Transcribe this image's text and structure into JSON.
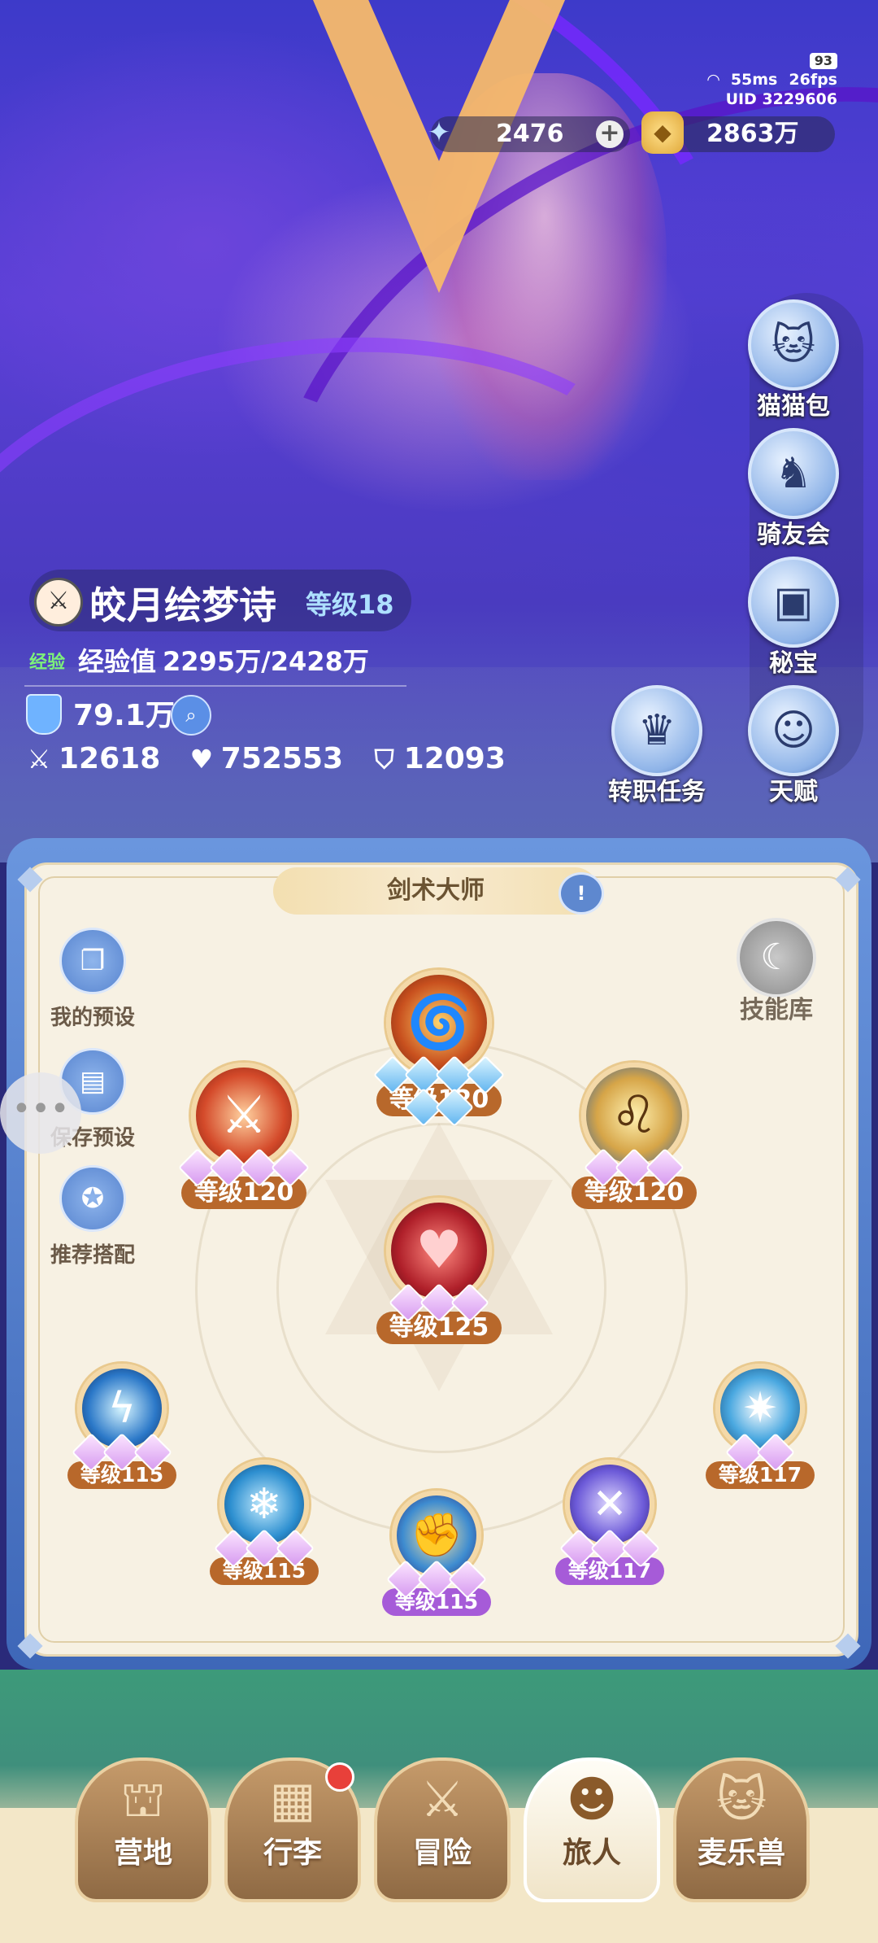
{
  "status": {
    "battery": "93",
    "ping": "55ms",
    "fps": "26fps",
    "uid": "UID 3229606"
  },
  "currency": {
    "gems": "2476",
    "gold": "2863万",
    "gem_icon": "star-crystal-icon",
    "gold_icon": "gold-coin-icon"
  },
  "side_menu": [
    {
      "label": "猫猫包",
      "icon": "cat-bag-icon"
    },
    {
      "label": "骑友会",
      "icon": "horse-icon"
    },
    {
      "label": "秘宝",
      "icon": "treasure-chest-icon"
    },
    {
      "label": "转职任务",
      "icon": "crown-icon"
    },
    {
      "label": "天赋",
      "icon": "brain-head-icon"
    }
  ],
  "character": {
    "name": "皎月绘梦诗",
    "level": "等级18",
    "exp_tag": "经验",
    "exp_label": "经验值",
    "exp_value": "2295万/2428万",
    "power": "79.1万",
    "attack": "12618",
    "hp": "752553",
    "defense": "12093"
  },
  "skill_panel": {
    "class_name": "剑术大师",
    "class_info_icon": "info-book-icon",
    "left_buttons": [
      {
        "label": "我的预设",
        "icon": "preset-icon"
      },
      {
        "label": "保存预设",
        "icon": "save-icon"
      },
      {
        "label": "推荐搭配",
        "icon": "recommend-icon"
      }
    ],
    "library_label": "技能库",
    "skills": [
      {
        "id": "top",
        "level": "等级120",
        "stars": 6,
        "star_color": "blue",
        "icon": "fire-swirl-icon"
      },
      {
        "id": "left",
        "level": "等级120",
        "stars": 4,
        "star_color": "pink",
        "icon": "red-warrior-icon"
      },
      {
        "id": "right",
        "level": "等级120",
        "stars": 3,
        "star_color": "pink",
        "icon": "lion-roar-icon"
      },
      {
        "id": "center",
        "level": "等级125",
        "stars": 3,
        "star_color": "pink",
        "icon": "red-heart-icon"
      },
      {
        "id": "b1",
        "level": "等级115",
        "stars": 3,
        "star_color": "pink",
        "icon": "lightning-sword-icon"
      },
      {
        "id": "b2",
        "level": "等级115",
        "stars": 3,
        "star_color": "pink",
        "icon": "ice-blade-icon"
      },
      {
        "id": "b3",
        "level": "等级115",
        "stars": 3,
        "star_color": "pink",
        "icon": "golden-fist-icon"
      },
      {
        "id": "b4",
        "level": "等级117",
        "stars": 3,
        "star_color": "pink",
        "icon": "crossed-blades-icon"
      },
      {
        "id": "b5",
        "level": "等级117",
        "stars": 2,
        "star_color": "pink",
        "icon": "slash-burst-icon"
      }
    ]
  },
  "nav": [
    {
      "label": "营地",
      "icon": "castle-icon",
      "active": false
    },
    {
      "label": "行李",
      "icon": "luggage-icon",
      "active": false,
      "badge": true
    },
    {
      "label": "冒险",
      "icon": "crossed-swords-icon",
      "active": false
    },
    {
      "label": "旅人",
      "icon": "hero-portrait-icon",
      "active": true
    },
    {
      "label": "麦乐兽",
      "icon": "beast-icon",
      "active": false
    }
  ]
}
